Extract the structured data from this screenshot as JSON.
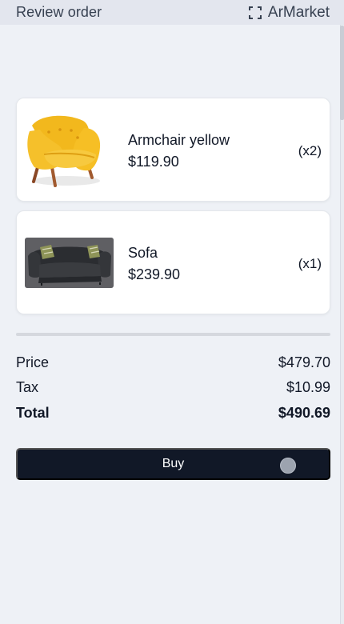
{
  "header": {
    "title": "Review order",
    "brand_icon": "scan-icon",
    "brand_name": "ArMarket"
  },
  "items": [
    {
      "name": "Armchair yellow",
      "price": "$119.90",
      "quantity": "(x2)",
      "image": "yellow-armchair"
    },
    {
      "name": "Sofa",
      "price": "$239.90",
      "quantity": "(x1)",
      "image": "dark-gray-sofa"
    }
  ],
  "summary": {
    "price_label": "Price",
    "price_value": "$479.70",
    "tax_label": "Tax",
    "tax_value": "$10.99",
    "total_label": "Total",
    "total_value": "$490.69"
  },
  "buy_button": {
    "label": "Buy"
  },
  "colors": {
    "background": "#eef1f6",
    "header_background": "#e3e6ee",
    "button_background": "#111827",
    "button_text": "#ffffff",
    "card_background": "#ffffff",
    "armchair": "#f4bd2c",
    "sofa": "#3a3c40"
  }
}
